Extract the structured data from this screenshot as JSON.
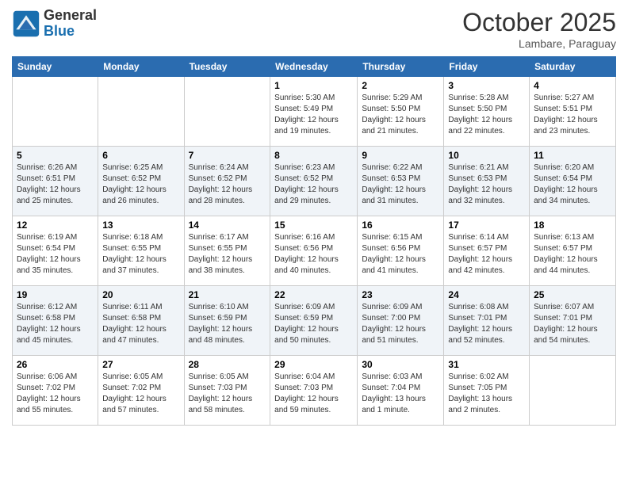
{
  "logo": {
    "general": "General",
    "blue": "Blue"
  },
  "header": {
    "month": "October 2025",
    "location": "Lambare, Paraguay"
  },
  "weekdays": [
    "Sunday",
    "Monday",
    "Tuesday",
    "Wednesday",
    "Thursday",
    "Friday",
    "Saturday"
  ],
  "weeks": [
    [
      {
        "day": "",
        "info": ""
      },
      {
        "day": "",
        "info": ""
      },
      {
        "day": "",
        "info": ""
      },
      {
        "day": "1",
        "info": "Sunrise: 5:30 AM\nSunset: 5:49 PM\nDaylight: 12 hours\nand 19 minutes."
      },
      {
        "day": "2",
        "info": "Sunrise: 5:29 AM\nSunset: 5:50 PM\nDaylight: 12 hours\nand 21 minutes."
      },
      {
        "day": "3",
        "info": "Sunrise: 5:28 AM\nSunset: 5:50 PM\nDaylight: 12 hours\nand 22 minutes."
      },
      {
        "day": "4",
        "info": "Sunrise: 5:27 AM\nSunset: 5:51 PM\nDaylight: 12 hours\nand 23 minutes."
      }
    ],
    [
      {
        "day": "5",
        "info": "Sunrise: 6:26 AM\nSunset: 6:51 PM\nDaylight: 12 hours\nand 25 minutes."
      },
      {
        "day": "6",
        "info": "Sunrise: 6:25 AM\nSunset: 6:52 PM\nDaylight: 12 hours\nand 26 minutes."
      },
      {
        "day": "7",
        "info": "Sunrise: 6:24 AM\nSunset: 6:52 PM\nDaylight: 12 hours\nand 28 minutes."
      },
      {
        "day": "8",
        "info": "Sunrise: 6:23 AM\nSunset: 6:52 PM\nDaylight: 12 hours\nand 29 minutes."
      },
      {
        "day": "9",
        "info": "Sunrise: 6:22 AM\nSunset: 6:53 PM\nDaylight: 12 hours\nand 31 minutes."
      },
      {
        "day": "10",
        "info": "Sunrise: 6:21 AM\nSunset: 6:53 PM\nDaylight: 12 hours\nand 32 minutes."
      },
      {
        "day": "11",
        "info": "Sunrise: 6:20 AM\nSunset: 6:54 PM\nDaylight: 12 hours\nand 34 minutes."
      }
    ],
    [
      {
        "day": "12",
        "info": "Sunrise: 6:19 AM\nSunset: 6:54 PM\nDaylight: 12 hours\nand 35 minutes."
      },
      {
        "day": "13",
        "info": "Sunrise: 6:18 AM\nSunset: 6:55 PM\nDaylight: 12 hours\nand 37 minutes."
      },
      {
        "day": "14",
        "info": "Sunrise: 6:17 AM\nSunset: 6:55 PM\nDaylight: 12 hours\nand 38 minutes."
      },
      {
        "day": "15",
        "info": "Sunrise: 6:16 AM\nSunset: 6:56 PM\nDaylight: 12 hours\nand 40 minutes."
      },
      {
        "day": "16",
        "info": "Sunrise: 6:15 AM\nSunset: 6:56 PM\nDaylight: 12 hours\nand 41 minutes."
      },
      {
        "day": "17",
        "info": "Sunrise: 6:14 AM\nSunset: 6:57 PM\nDaylight: 12 hours\nand 42 minutes."
      },
      {
        "day": "18",
        "info": "Sunrise: 6:13 AM\nSunset: 6:57 PM\nDaylight: 12 hours\nand 44 minutes."
      }
    ],
    [
      {
        "day": "19",
        "info": "Sunrise: 6:12 AM\nSunset: 6:58 PM\nDaylight: 12 hours\nand 45 minutes."
      },
      {
        "day": "20",
        "info": "Sunrise: 6:11 AM\nSunset: 6:58 PM\nDaylight: 12 hours\nand 47 minutes."
      },
      {
        "day": "21",
        "info": "Sunrise: 6:10 AM\nSunset: 6:59 PM\nDaylight: 12 hours\nand 48 minutes."
      },
      {
        "day": "22",
        "info": "Sunrise: 6:09 AM\nSunset: 6:59 PM\nDaylight: 12 hours\nand 50 minutes."
      },
      {
        "day": "23",
        "info": "Sunrise: 6:09 AM\nSunset: 7:00 PM\nDaylight: 12 hours\nand 51 minutes."
      },
      {
        "day": "24",
        "info": "Sunrise: 6:08 AM\nSunset: 7:01 PM\nDaylight: 12 hours\nand 52 minutes."
      },
      {
        "day": "25",
        "info": "Sunrise: 6:07 AM\nSunset: 7:01 PM\nDaylight: 12 hours\nand 54 minutes."
      }
    ],
    [
      {
        "day": "26",
        "info": "Sunrise: 6:06 AM\nSunset: 7:02 PM\nDaylight: 12 hours\nand 55 minutes."
      },
      {
        "day": "27",
        "info": "Sunrise: 6:05 AM\nSunset: 7:02 PM\nDaylight: 12 hours\nand 57 minutes."
      },
      {
        "day": "28",
        "info": "Sunrise: 6:05 AM\nSunset: 7:03 PM\nDaylight: 12 hours\nand 58 minutes."
      },
      {
        "day": "29",
        "info": "Sunrise: 6:04 AM\nSunset: 7:03 PM\nDaylight: 12 hours\nand 59 minutes."
      },
      {
        "day": "30",
        "info": "Sunrise: 6:03 AM\nSunset: 7:04 PM\nDaylight: 13 hours\nand 1 minute."
      },
      {
        "day": "31",
        "info": "Sunrise: 6:02 AM\nSunset: 7:05 PM\nDaylight: 13 hours\nand 2 minutes."
      },
      {
        "day": "",
        "info": ""
      }
    ]
  ]
}
